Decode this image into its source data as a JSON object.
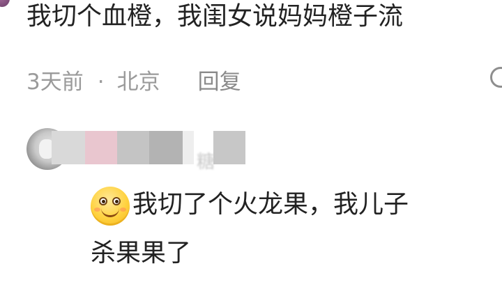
{
  "comment": {
    "text": "我切个血橙，我闺女说妈妈橙子流",
    "time": "3天前",
    "separator": "·",
    "location": "北京",
    "reply_label": "回复"
  },
  "reply": {
    "username_tail": "糖",
    "emoji_icon": "smiling-face-emoji",
    "line1": "我切了个火龙果，我儿子",
    "line2": "杀果果了"
  },
  "icons": {
    "edge_icon": "comment-icon"
  },
  "colors": {
    "text": "#222222",
    "meta": "#9a9a9a",
    "background": "#ffffff"
  }
}
